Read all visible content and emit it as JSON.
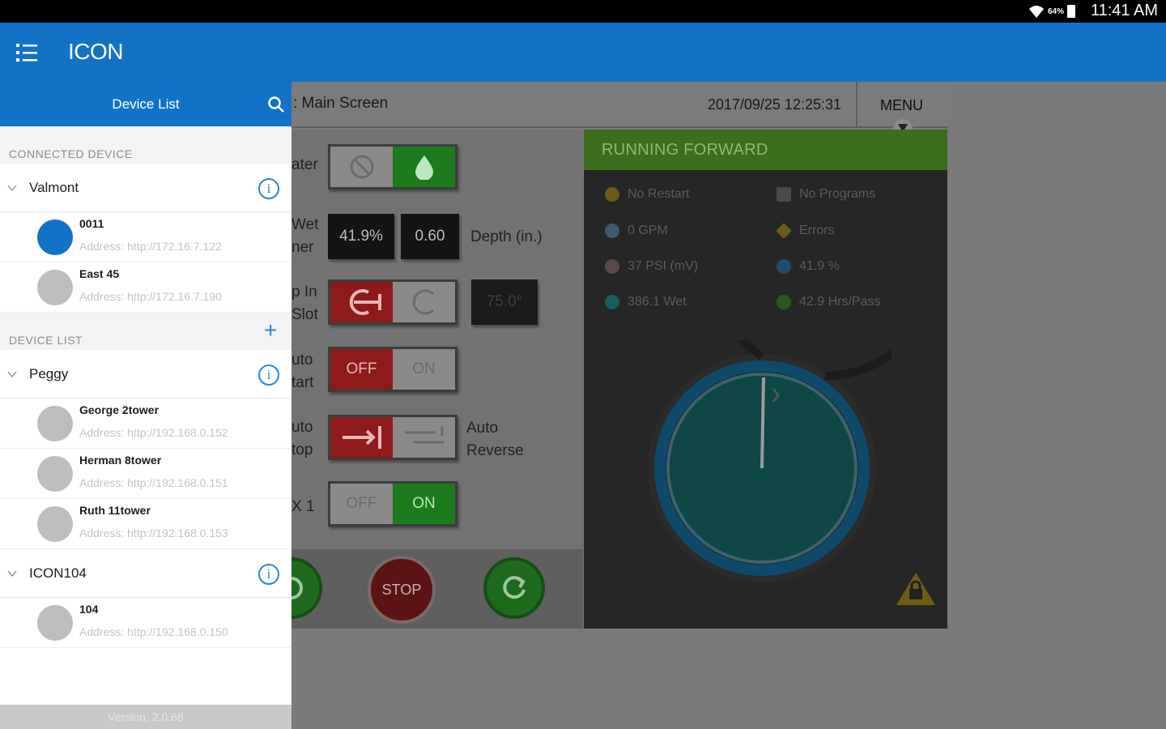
{
  "status_bar": {
    "battery_pct": "64%",
    "time": "11:41 AM"
  },
  "app_bar": {
    "title": "ICON"
  },
  "main_screen": {
    "title": ": Main Screen",
    "datetime": "2017/09/25 12:25:31",
    "menu_label": "MENU",
    "labels": {
      "water": "ater",
      "wet_1": "Wet",
      "wet_2": "ner",
      "slot_1": "p In",
      "slot_2": "Slot",
      "auto_start_1": "uto",
      "auto_start_2": "tart",
      "auto_stop_1": "uto",
      "auto_stop_2": "top",
      "x1": "X 1",
      "depth": "Depth (in.)",
      "auto_reverse_1": "Auto",
      "auto_reverse_2": "Reverse"
    },
    "values": {
      "percent": "41.9%",
      "depth": "0.60",
      "angle": "75.0°"
    },
    "switches": {
      "auto_start": {
        "off": "OFF",
        "on": "ON"
      },
      "x1": {
        "off": "OFF",
        "on": "ON"
      }
    },
    "stop_label": "STOP",
    "status_banner": "RUNNING FORWARD",
    "stats": {
      "restart": "No Restart",
      "programs": "No Programs",
      "gpm": "0 GPM",
      "errors": "Errors",
      "psi": "37 PSI (mV)",
      "percent": "41.9 %",
      "wet": "386.1 Wet",
      "hrs_pass": "42.9 Hrs/Pass"
    }
  },
  "drawer": {
    "title": "Device List",
    "connected_header": "CONNECTED DEVICE",
    "device_list_header": "DEVICE LIST",
    "add_symbol": "+",
    "info_symbol": "i",
    "connected_group": {
      "name": "Valmont",
      "devices": [
        {
          "name": "0011",
          "address": "Address: http://172.16.7.122"
        },
        {
          "name": "East 45",
          "address": "Address: http://172.16.7.190"
        }
      ]
    },
    "groups": [
      {
        "name": "Peggy",
        "devices": [
          {
            "name": "George 2tower",
            "address": "Address: http://192.168.0.152"
          },
          {
            "name": "Herman 8tower",
            "address": "Address: http://192.168.0.151"
          },
          {
            "name": "Ruth 11tower",
            "address": "Address: http://192.168.0.153"
          }
        ]
      },
      {
        "name": "ICON104",
        "devices": [
          {
            "name": "104",
            "address": "Address: http://192.168.0.150"
          }
        ]
      }
    ],
    "version": "Version: 2.0.66"
  },
  "colors": {
    "brand_blue": "#1273c6",
    "active_device": "#1273c6",
    "info_blue": "#2a86d4",
    "running_green": "#3c6f1d"
  }
}
